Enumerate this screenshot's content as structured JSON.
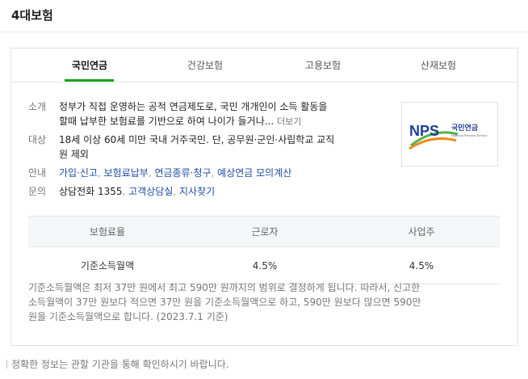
{
  "header": {
    "title": "4대보험"
  },
  "tabs": [
    {
      "label": "국민연금"
    },
    {
      "label": "건강보험"
    },
    {
      "label": "고용보험"
    },
    {
      "label": "산재보험"
    }
  ],
  "info": {
    "intro": {
      "key": "소개",
      "line1": "정부가 직접 운영하는 공적 연금제도로, 국민 개개인이 소득 활동을",
      "line2": "할때 납부한 보험료를 기반으로 하여 나이가 들거나...",
      "more": "더보기"
    },
    "target": {
      "key": "대상",
      "line1": "18세 이상 60세 미만 국내 거주국민. 단, 공무원·군인·사립학교 교직",
      "line2": "원 제외"
    },
    "guide": {
      "key": "안내",
      "links": [
        "가입·신고",
        "보험료납부",
        "연금종류·청구",
        "예상연금 모의계산"
      ]
    },
    "contact": {
      "key": "문의",
      "phone": "상담전화 1355",
      "links": [
        "고객상담실",
        "지사찾기"
      ]
    }
  },
  "logo": {
    "text": "NPS",
    "kr": "국민연금",
    "en": "National Pension Service",
    "colors": {
      "blue": "#1d3f94",
      "green": "#55b04a",
      "orange": "#f08a1c"
    }
  },
  "rates_table": {
    "headers": [
      "보험료율",
      "근로자",
      "사업주"
    ],
    "rows": [
      [
        "기준소득월액",
        "4.5%",
        "4.5%"
      ]
    ]
  },
  "note": {
    "line1": "기준소득월액은 최저 37만 원에서 최고 590만 원까지의 범위로 결정하게 됩니다. 따라서, 신고한",
    "line2": "소득월액이 37만 원보다 적으면 37만 원을 기준소득월액으로 하고, 590만 원보다 많으면 590만",
    "line3": "원을 기준소득월액으로 합니다. (2023.7.1 기준)"
  },
  "footer": {
    "text": "정확한 정보는 관할 기관을 통해 확인하시기 바랍니다."
  },
  "colors": {
    "accent": "#1aa01a",
    "link": "#1e4fa5"
  }
}
